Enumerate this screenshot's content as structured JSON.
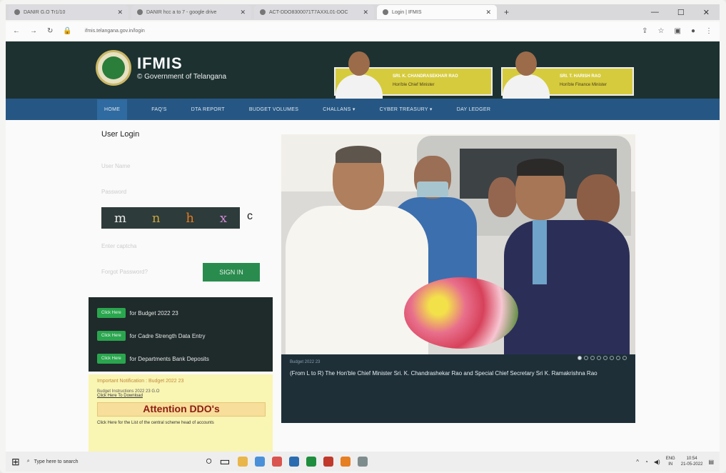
{
  "browser": {
    "tabs": [
      {
        "label": "DANIR G.O Tr1/10",
        "favicon": "doc-icon"
      },
      {
        "label": "DANIR hcc a to 7 - google drive",
        "favicon": "doc-icon"
      },
      {
        "label": "ACT-DDO8300071T7AXXL01-DOC",
        "favicon": "doc-icon"
      },
      {
        "label": "Login | IFMIS",
        "favicon": "site-icon",
        "active": true
      }
    ],
    "url": "ifmis.telangana.gov.in/login"
  },
  "header": {
    "brand": "IFMIS",
    "subtitle": "© Government of Telangana",
    "leaders": [
      {
        "name": "SRI. K. CHANDRASEKHAR RAO",
        "role": "Hon'ble Chief Minister"
      },
      {
        "name": "SRI. T. HARISH RAO",
        "role": "Hon'ble Finance Minister"
      }
    ]
  },
  "nav": {
    "items": [
      "HOME",
      "FAQ'S",
      "DTA REPORT",
      "BUDGET VOLUMES",
      "CHALLANS",
      "CYBER TREASURY",
      "DAY LEDGER"
    ],
    "active": "HOME"
  },
  "login": {
    "title": "User Login",
    "user_placeholder": "User Name",
    "password_placeholder": "Password",
    "captcha_chars": [
      "m",
      "n",
      "h",
      "x"
    ],
    "captcha_colors": [
      "#e6e6e6",
      "#c9a23c",
      "#e37a1f",
      "#d38ad6"
    ],
    "captcha_placeholder": "Enter captcha",
    "forgot": "Forgot Password?",
    "signin_label": "SIGN IN"
  },
  "quick_links": [
    {
      "button": "Click Here",
      "text": "for Budget 2022 23"
    },
    {
      "button": "Click Here",
      "text": "for Cadre Strength Data Entry"
    },
    {
      "button": "Click Here",
      "text": "for Departments Bank Deposits"
    }
  ],
  "notice": {
    "heading": "Important Notification : Budget 2022 23",
    "instructions": "Budget Instructions 2022 23 G.O",
    "download": "Click Here To Download",
    "attention": "Attention DDO's",
    "list_text": "Click Here for the List of the central scheme head of accounts"
  },
  "carousel": {
    "small_label": "Budget 2022 23",
    "caption": "(From L to R) The Hon'ble Chief Minister Sri. K. Chandrashekar Rao and Special Chief Secretary Sri K. Ramakrishna Rao",
    "dot_count": 8,
    "active_dot": 0
  },
  "taskbar": {
    "search_placeholder": "Type here to search",
    "lang": "ENG",
    "region": "IN",
    "time": "10:54",
    "date": "21-05-2022"
  },
  "colors": {
    "header_bg": "#1d3131",
    "nav_bg": "#265784",
    "signin_bg": "#2a8b4e",
    "notice_bg": "#f9f5b3"
  }
}
